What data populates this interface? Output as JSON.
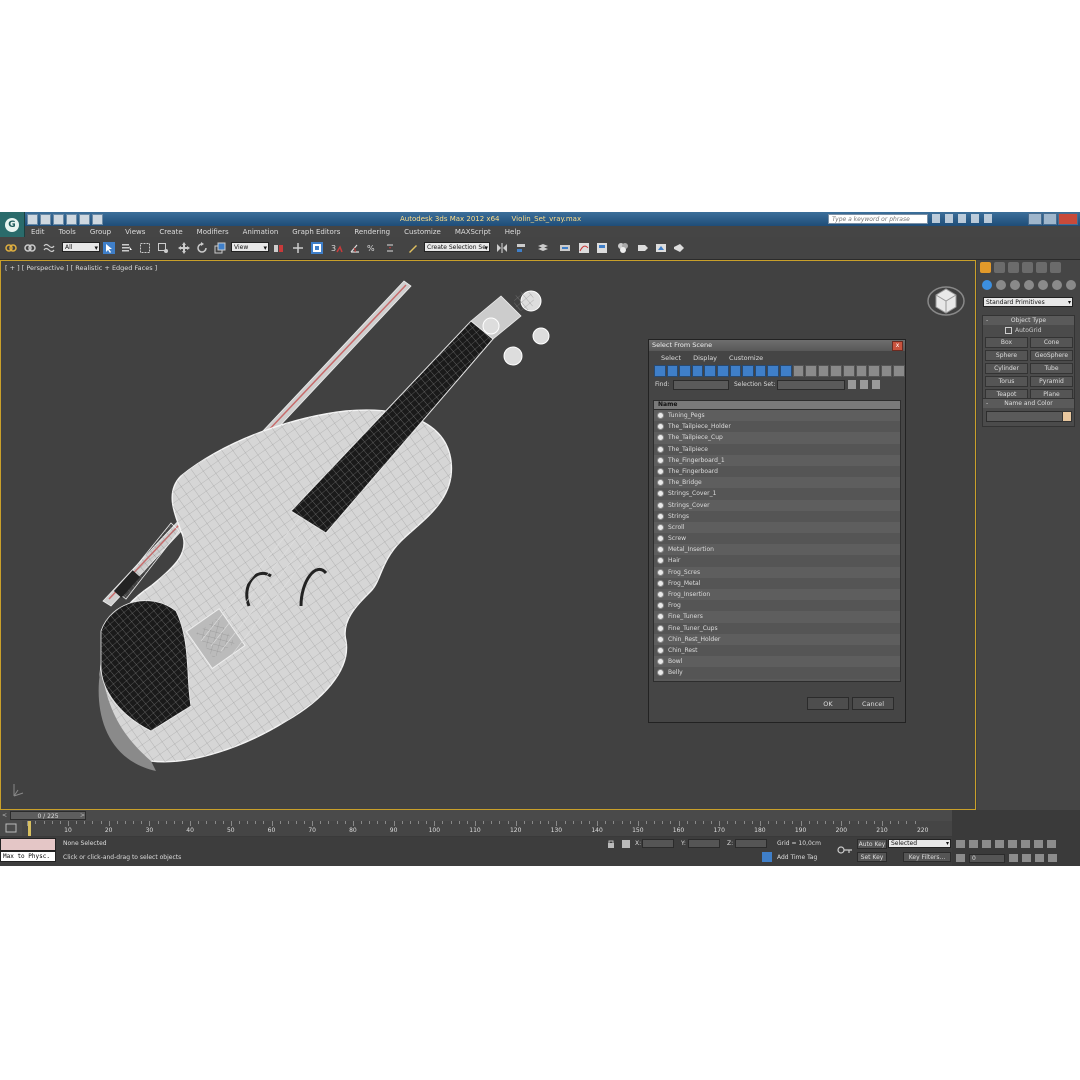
{
  "app": {
    "title": "Autodesk 3ds Max  2012 x64",
    "file": "Violin_Set_vray.max",
    "search_placeholder": "Type a keyword or phrase"
  },
  "menu": [
    "Edit",
    "Tools",
    "Group",
    "Views",
    "Create",
    "Modifiers",
    "Animation",
    "Graph Editors",
    "Rendering",
    "Customize",
    "MAXScript",
    "Help"
  ],
  "toolbar": {
    "selection_filter": "All",
    "ref_coord": "View",
    "named_selection": "Create Selection Se"
  },
  "viewport": {
    "label": "[ + ] [ Perspective ] [ Realistic + Edged Faces ]"
  },
  "command_panel": {
    "category": "Standard Primitives",
    "object_type_title": "Object Type",
    "autogrid": "AutoGrid",
    "primitives": [
      "Box",
      "Cone",
      "Sphere",
      "GeoSphere",
      "Cylinder",
      "Tube",
      "Torus",
      "Pyramid",
      "Teapot",
      "Plane"
    ],
    "name_color_title": "Name and Color"
  },
  "dialog": {
    "title": "Select From Scene",
    "menu": [
      "Select",
      "Display",
      "Customize"
    ],
    "find_label": "Find:",
    "selection_set_label": "Selection Set:",
    "column_name": "Name",
    "items": [
      "Tuning_Pegs",
      "The_Tailpiece_Holder",
      "The_Tailpiece_Cup",
      "The_Tailpiece",
      "The_Fingerboard_1",
      "The_Fingerboard",
      "The_Bridge",
      "Strings_Cover_1",
      "Strings_Cover",
      "Strings",
      "Scroll",
      "Screw",
      "Metal_Insertion",
      "Hair",
      "Frog_Scres",
      "Frog_Metal",
      "Frog_Insertion",
      "Frog",
      "Fine_Tuners",
      "Fine_Tuner_Cups",
      "Chin_Rest_Holder",
      "Chin_Rest",
      "Bowl",
      "Belly"
    ],
    "ok": "OK",
    "cancel": "Cancel"
  },
  "timeline": {
    "frame": "0 / 225",
    "ticks": [
      "10",
      "20",
      "30",
      "40",
      "50",
      "60",
      "70",
      "80",
      "90",
      "100",
      "110",
      "120",
      "130",
      "140",
      "150",
      "160",
      "170",
      "180",
      "190",
      "200",
      "210",
      "220"
    ]
  },
  "status": {
    "maxscript": "Max to Physc.",
    "selection": "None Selected",
    "prompt": "Click or click-and-drag to select objects",
    "x_label": "X:",
    "y_label": "Y:",
    "z_label": "Z:",
    "grid": "Grid = 10,0cm",
    "add_time_tag": "Add Time Tag",
    "auto_key": "Auto Key",
    "key_mode": "Selected",
    "set_key": "Set Key",
    "key_filters": "Key Filters...",
    "current_frame": "0"
  }
}
